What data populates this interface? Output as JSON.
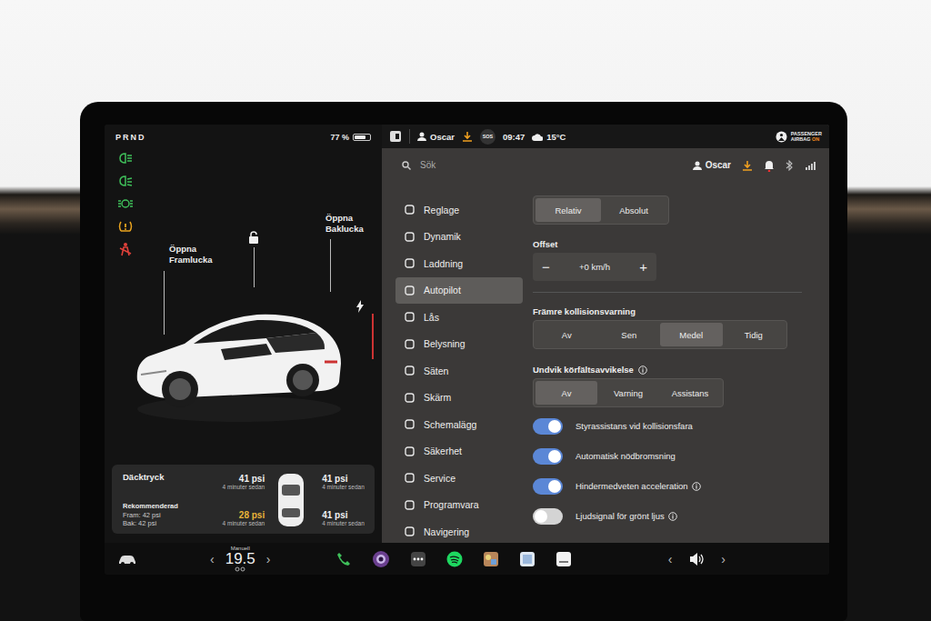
{
  "left": {
    "gear": "PRND",
    "battery": {
      "text": "77 %",
      "level": 0.77
    },
    "indicators": [
      {
        "color": "#3fbf5a"
      },
      {
        "color": "#3fbf5a"
      },
      {
        "color": "#3fbf5a"
      },
      {
        "color": "#e8a21e"
      },
      {
        "color": "#e0413a"
      }
    ],
    "car_labels": {
      "frunk": "Öppna Framlucka",
      "trunk": "Öppna Baklucka"
    },
    "tires": {
      "title": "Däcktryck",
      "recommended": "Rekommenderad",
      "front": "Fram: 42 psi",
      "rear": "Bak: 42 psi",
      "items": [
        {
          "value": "41 psi",
          "time": "4 minuter sedan",
          "warning": false
        },
        {
          "value": "41 psi",
          "time": "4 minuter sedan",
          "warning": false
        },
        {
          "value": "28 psi",
          "time": "4 minuter sedan",
          "warning": true
        },
        {
          "value": "41 psi",
          "time": "4 minuter sedan",
          "warning": false
        }
      ]
    }
  },
  "status_bar": {
    "user": "Oscar",
    "sos": "SOS",
    "time": "09:47",
    "temperature": "15°C",
    "airbag": {
      "line1": "PASSENGER",
      "line2": "AIRBAG",
      "state": "ON"
    }
  },
  "search": {
    "placeholder": "Sök"
  },
  "header_user": "Oscar",
  "sidebar": {
    "items": [
      {
        "label": "Reglage",
        "selected": false
      },
      {
        "label": "Dynamik",
        "selected": false
      },
      {
        "label": "Laddning",
        "selected": false
      },
      {
        "label": "Autopilot",
        "selected": true
      },
      {
        "label": "Lås",
        "selected": false
      },
      {
        "label": "Belysning",
        "selected": false
      },
      {
        "label": "Säten",
        "selected": false
      },
      {
        "label": "Skärm",
        "selected": false
      },
      {
        "label": "Schemalägg",
        "selected": false
      },
      {
        "label": "Säkerhet",
        "selected": false
      },
      {
        "label": "Service",
        "selected": false
      },
      {
        "label": "Programvara",
        "selected": false
      },
      {
        "label": "Navigering",
        "selected": false
      }
    ]
  },
  "settings": {
    "offset_mode": [
      {
        "label": "Relativ",
        "selected": true
      },
      {
        "label": "Absolut",
        "selected": false
      }
    ],
    "offset": {
      "label": "Offset",
      "minus": "−",
      "value": "+0 km/h",
      "plus": "+"
    },
    "collision_warning": {
      "label": "Främre kollisionsvarning",
      "options": [
        {
          "label": "Av",
          "selected": false
        },
        {
          "label": "Sen",
          "selected": false
        },
        {
          "label": "Medel",
          "selected": true
        },
        {
          "label": "Tidig",
          "selected": false
        }
      ]
    },
    "lane_departure": {
      "label": "Undvik körfältsavvikelse",
      "options": [
        {
          "label": "Av",
          "selected": true
        },
        {
          "label": "Varning",
          "selected": false
        },
        {
          "label": "Assistans",
          "selected": false
        }
      ]
    },
    "toggles": [
      {
        "label": "Styrassistans vid kollisionsfara",
        "on": true,
        "info": false
      },
      {
        "label": "Automatisk nödbromsning",
        "on": true,
        "info": false
      },
      {
        "label": "Hindermedveten acceleration",
        "on": true,
        "info": true
      },
      {
        "label": "Ljudsignal för grönt ljus",
        "on": false,
        "info": true
      }
    ]
  },
  "bottom_bar": {
    "temp_left": "‹",
    "temp_mode": "Manuell",
    "temp": "19.5",
    "temp_right": "›",
    "vol_left": "‹",
    "vol_right": "›"
  }
}
